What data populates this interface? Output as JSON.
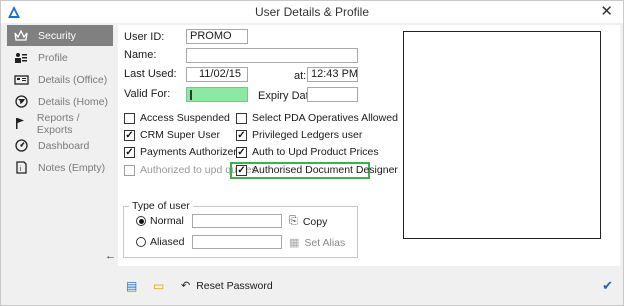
{
  "window": {
    "title": "User Details & Profile"
  },
  "sidebar": {
    "items": [
      {
        "label": "Security",
        "icon": "crown-icon"
      },
      {
        "label": "Profile",
        "icon": "user-profile-icon"
      },
      {
        "label": "Details (Office)",
        "icon": "office-icon"
      },
      {
        "label": "Details (Home)",
        "icon": "globe-icon"
      },
      {
        "label": "Reports / Exports",
        "icon": "flag-icon"
      },
      {
        "label": "Dashboard",
        "icon": "dashboard-icon"
      },
      {
        "label": "Notes (Empty)",
        "icon": "notes-icon"
      }
    ],
    "active_index": 0
  },
  "form": {
    "user_id_label": "User ID:",
    "user_id_value": "PROMO",
    "name_label": "Name:",
    "name_value": "",
    "last_used_label": "Last Used:",
    "last_used_value": "11/02/15",
    "at_label": "at:",
    "at_value": "12:43 PM",
    "valid_for_label": "Valid For:",
    "valid_for_value": "",
    "expiry_label": "Expiry Date:",
    "expiry_value": ""
  },
  "checkboxes": [
    {
      "label": "Access Suspended",
      "checked": false,
      "disabled": false
    },
    {
      "label": "Select PDA Operatives Allowed",
      "checked": false,
      "disabled": false
    },
    {
      "label": "CRM Super User",
      "checked": true,
      "disabled": false
    },
    {
      "label": "Privileged Ledgers user",
      "checked": true,
      "disabled": false
    },
    {
      "label": "Payments Authorizer",
      "checked": true,
      "disabled": false
    },
    {
      "label": "Auth to Upd Product Prices",
      "checked": true,
      "disabled": false
    },
    {
      "label": "Authorized to upd quotes",
      "checked": false,
      "disabled": true
    },
    {
      "label": "Authorised Document Designer",
      "checked": true,
      "disabled": false
    }
  ],
  "type_of_user": {
    "title": "Type of user",
    "normal_label": "Normal",
    "aliased_label": "Aliased",
    "selected": "Normal",
    "copy_label": "Copy",
    "set_alias_label": "Set Alias"
  },
  "footer": {
    "reset_password_label": "Reset Password"
  },
  "colors": {
    "active_sidebar": "#808080",
    "valid_for_field": "#8de8a4",
    "highlight_border": "#3ab34a",
    "ok_check": "#2d5fb3"
  }
}
